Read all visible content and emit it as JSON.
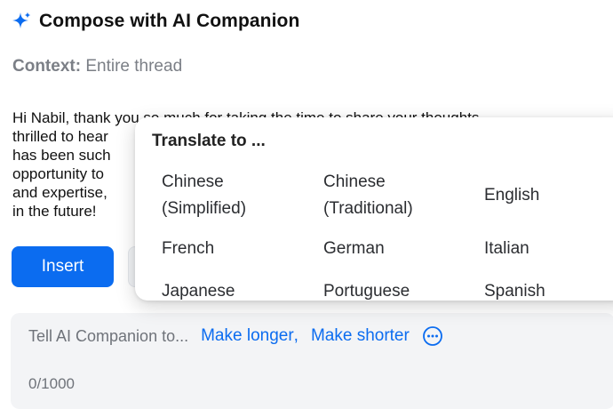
{
  "header": {
    "title": "Compose with AI Companion",
    "icon": "sparkle-icon",
    "accent": "#0b6cf0"
  },
  "context": {
    "label": "Context:",
    "value": "Entire thread"
  },
  "draft": {
    "lines": [
      "Hi Nabil, thank you so much for taking the time to share your thoughts.",
      "thrilled to hear",
      "has been such",
      "opportunity to",
      "and expertise,",
      "in the future!"
    ]
  },
  "actions": {
    "insert_label": "Insert"
  },
  "translate_popup": {
    "title": "Translate to ...",
    "languages": [
      {
        "line1": "Chinese",
        "line2": "(Simplified)"
      },
      {
        "line1": "Chinese",
        "line2": "(Traditional)"
      },
      {
        "line1": "English",
        "line2": ""
      },
      {
        "line1": "French",
        "line2": ""
      },
      {
        "line1": "German",
        "line2": ""
      },
      {
        "line1": "Italian",
        "line2": ""
      },
      {
        "line1": "Japanese",
        "line2": ""
      },
      {
        "line1": "Portuguese",
        "line2": ""
      },
      {
        "line1": "Spanish",
        "line2": ""
      }
    ]
  },
  "prompt": {
    "placeholder": "Tell AI Companion to...",
    "suggestions": [
      "Make longer",
      "Make shorter"
    ],
    "separator": ",",
    "more_icon": "more-options-icon",
    "counter": "0/1000"
  }
}
